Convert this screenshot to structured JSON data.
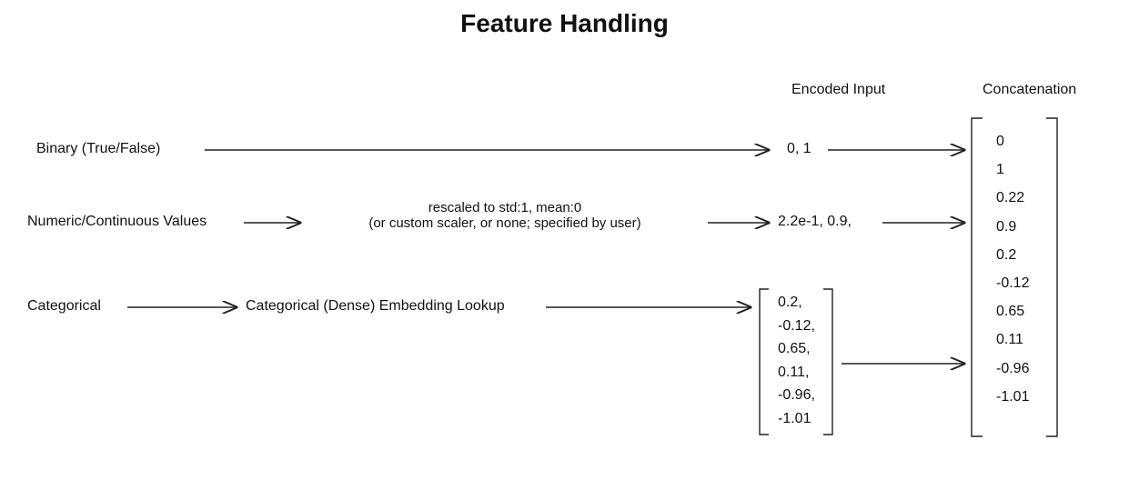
{
  "title": "Feature Handling",
  "columns": {
    "encoded": "Encoded Input",
    "concat": "Concatenation"
  },
  "rows": {
    "binary": {
      "label": "Binary (True/False)",
      "encoded": "0, 1"
    },
    "numeric": {
      "label": "Numeric/Continuous Values",
      "transform_line1": "rescaled to std:1, mean:0",
      "transform_line2": "(or custom scaler, or none; specified by user)",
      "encoded": "2.2e-1, 0.9,"
    },
    "categorical": {
      "label": "Categorical",
      "transform": "Categorical (Dense) Embedding Lookup",
      "vector": [
        "0.2,",
        "-0.12,",
        "0.65,",
        "0.11,",
        "-0.96,",
        "-1.01"
      ]
    }
  },
  "concat_vector": [
    "0",
    "1",
    "0.22",
    "0.9",
    "0.2",
    "-0.12",
    "0.65",
    "0.11",
    "-0.96",
    "-1.01"
  ]
}
